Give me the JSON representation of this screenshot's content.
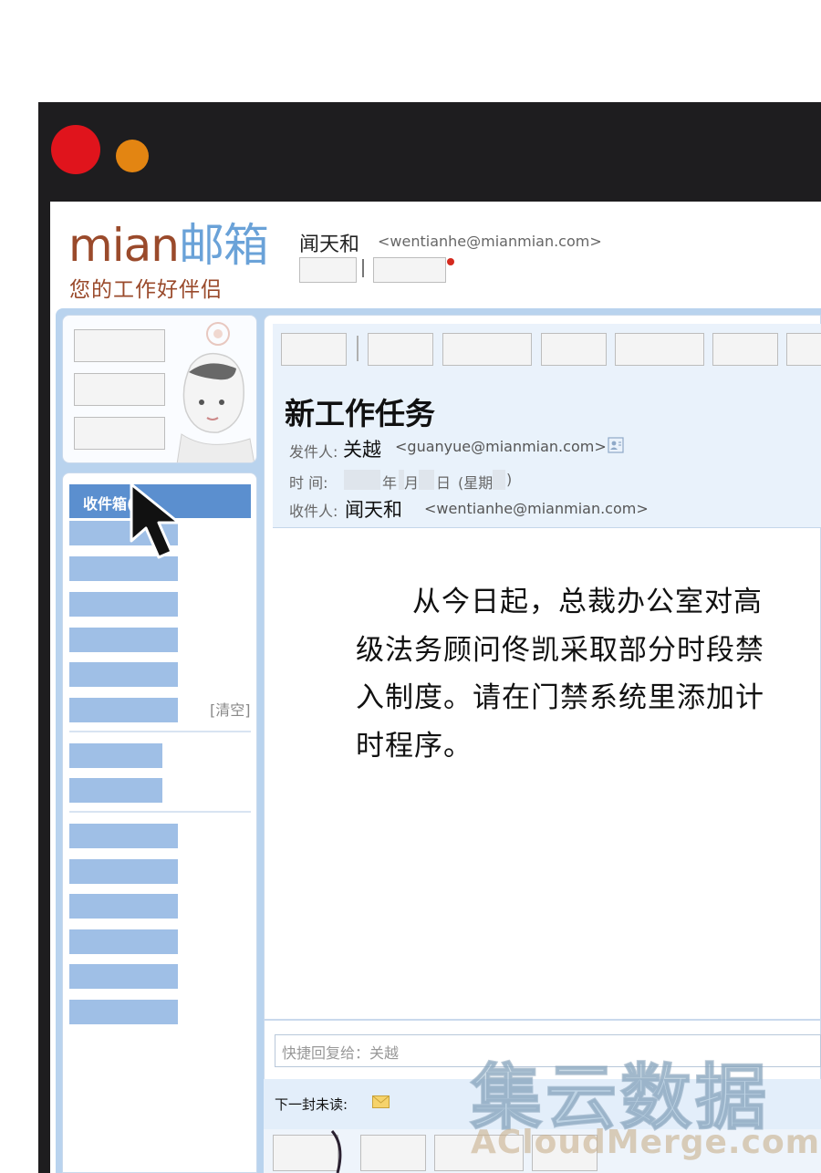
{
  "window": {
    "close_color": "#e0141c",
    "minimize_color": "#e38512"
  },
  "app": {
    "logo_latin": "mian",
    "logo_cjk": "邮箱",
    "slogan": "您的工作好伴侣",
    "brand_brown": "#9a4a2b",
    "brand_blue": "#6aa2d8"
  },
  "user": {
    "name": "闻天和",
    "email": "<wentianhe@mianmian.com>"
  },
  "sidebar": {
    "inbox_label": "收件箱(   )",
    "clear_label": "[清空]"
  },
  "message": {
    "subject": "新工作任务",
    "from_label": "发件人:",
    "from_name": "关越",
    "from_email": "<guanyue@mianmian.com>",
    "time_label": "时  间:",
    "time_year": "年",
    "time_month": "月",
    "time_day": "日",
    "time_weekday_open": "(星期",
    "time_weekday_close": ")",
    "to_label": "收件人:",
    "to_name": "闻天和",
    "to_email": "<wentianhe@mianmian.com>",
    "body": "从今日起，总裁办公室对高级法务顾问佟凯采取部分时段禁入制度。请在门禁系统里添加计时程序。"
  },
  "footer": {
    "quick_reply_placeholder": "快捷回复给：关越",
    "next_unread_label": "下一封未读:"
  },
  "watermark": {
    "cjk": "集云数据",
    "latin": "ACloudMerge.com"
  }
}
